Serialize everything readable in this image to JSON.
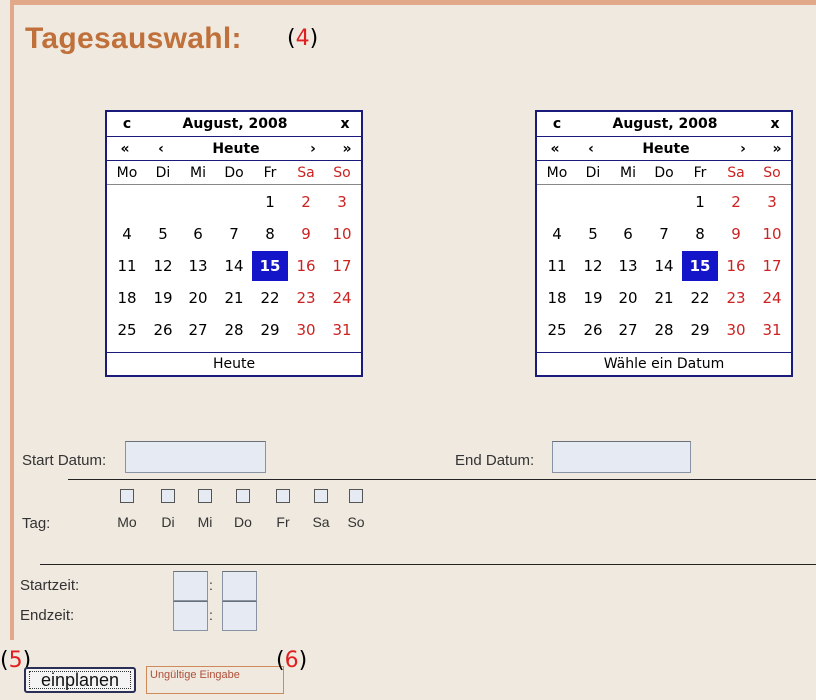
{
  "title": "Tagesauswahl:",
  "markers": {
    "title": "4",
    "button": "5",
    "error": "6"
  },
  "calendars": [
    {
      "clear": "c",
      "month": "August, 2008",
      "close": "x",
      "nav": [
        "«",
        "‹",
        "Heute",
        "›",
        "»"
      ],
      "weekdays": [
        "Mo",
        "Di",
        "Mi",
        "Do",
        "Fr",
        "Sa",
        "So"
      ],
      "weeks": [
        [
          "",
          "",
          "",
          "",
          "1",
          "2",
          "3"
        ],
        [
          "4",
          "5",
          "6",
          "7",
          "8",
          "9",
          "10"
        ],
        [
          "11",
          "12",
          "13",
          "14",
          "15",
          "16",
          "17"
        ],
        [
          "18",
          "19",
          "20",
          "21",
          "22",
          "23",
          "24"
        ],
        [
          "25",
          "26",
          "27",
          "28",
          "29",
          "30",
          "31"
        ]
      ],
      "selected": "15",
      "footer": "Heute"
    },
    {
      "clear": "c",
      "month": "August, 2008",
      "close": "x",
      "nav": [
        "«",
        "‹",
        "Heute",
        "›",
        "»"
      ],
      "weekdays": [
        "Mo",
        "Di",
        "Mi",
        "Do",
        "Fr",
        "Sa",
        "So"
      ],
      "weeks": [
        [
          "",
          "",
          "",
          "",
          "1",
          "2",
          "3"
        ],
        [
          "4",
          "5",
          "6",
          "7",
          "8",
          "9",
          "10"
        ],
        [
          "11",
          "12",
          "13",
          "14",
          "15",
          "16",
          "17"
        ],
        [
          "18",
          "19",
          "20",
          "21",
          "22",
          "23",
          "24"
        ],
        [
          "25",
          "26",
          "27",
          "28",
          "29",
          "30",
          "31"
        ]
      ],
      "selected": "15",
      "footer": "Wähle ein Datum"
    }
  ],
  "form": {
    "start_label": "Start Datum:",
    "end_label": "End Datum:",
    "start_value": "",
    "end_value": "",
    "day_label": "Tag:",
    "days": [
      "Mo",
      "Di",
      "Mi",
      "Do",
      "Fr",
      "Sa",
      "So"
    ],
    "starttime_label": "Startzeit:",
    "endtime_label": "Endzeit:",
    "colon": ":"
  },
  "button_label": "einplanen",
  "error_text": "Ungültige Eingabe",
  "colors": {
    "title": "#c0703a",
    "calendar_border": "#1a1a7a",
    "selected_day": "#1414c8",
    "weekend": "#cc2222",
    "error": "#b0503a"
  }
}
